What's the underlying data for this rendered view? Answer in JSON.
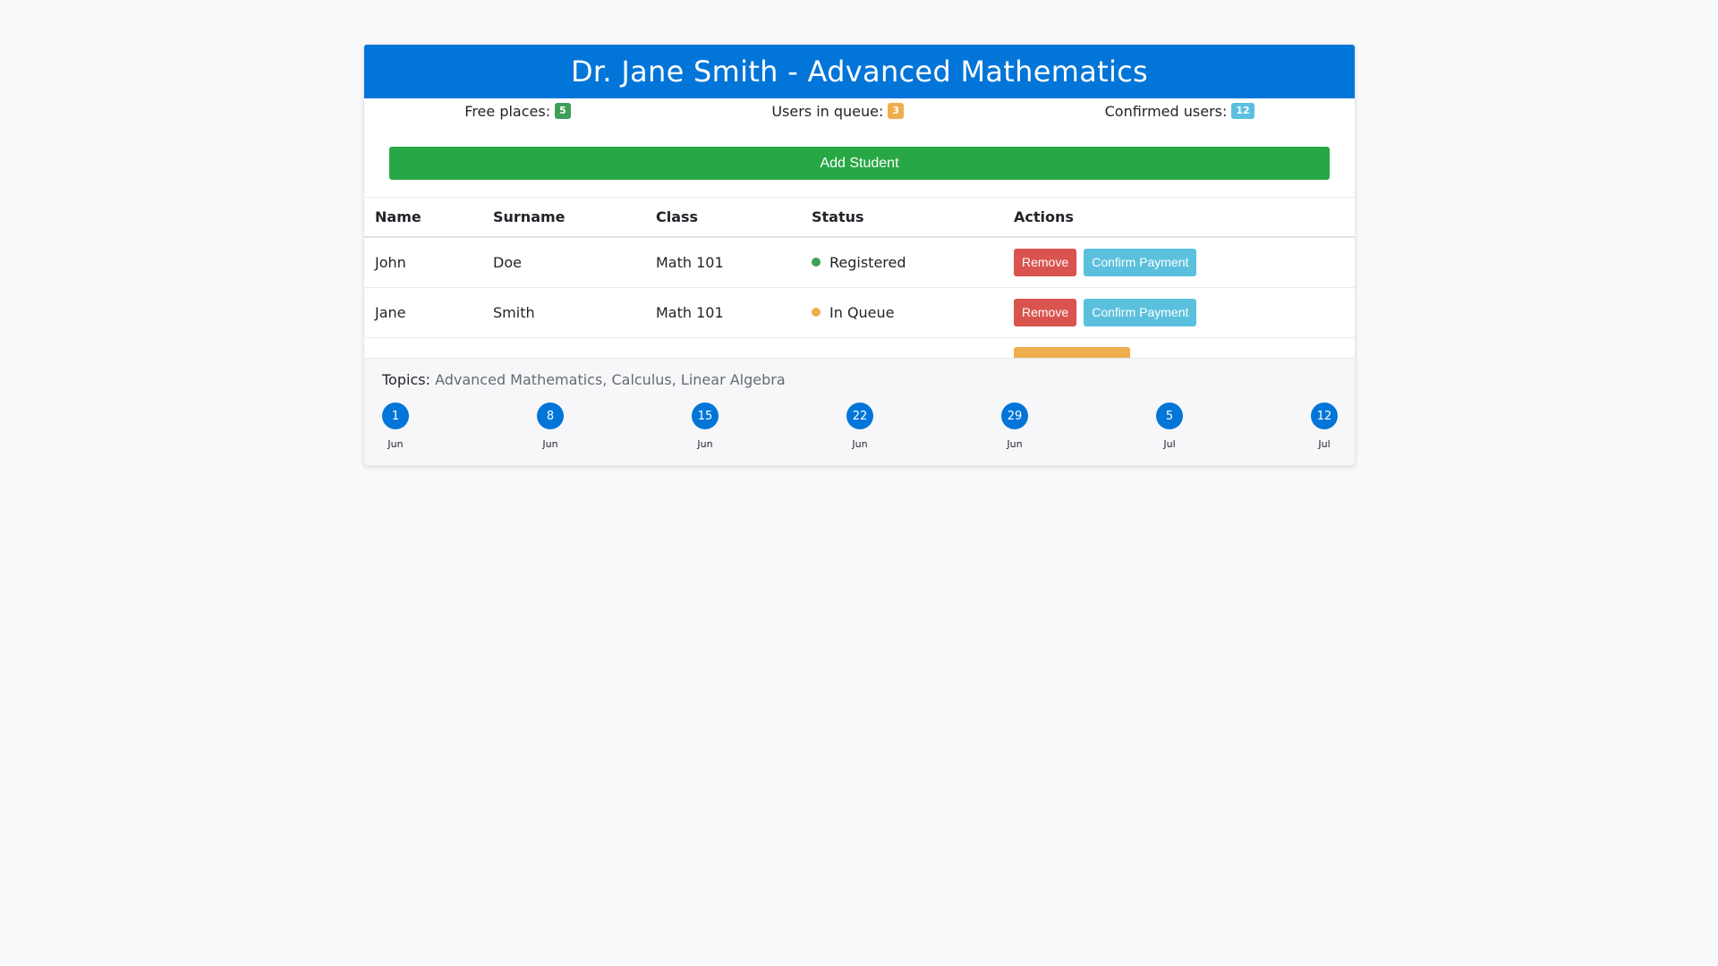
{
  "header": {
    "title": "Dr. Jane Smith - Advanced Mathematics"
  },
  "stats": {
    "free_label": "Free places:",
    "free_count": "5",
    "queue_label": "Users in queue:",
    "queue_count": "3",
    "confirmed_label": "Confirmed users:",
    "confirmed_count": "12"
  },
  "colors": {
    "primary": "#0275d8",
    "success": "#28a745",
    "danger": "#d9534f",
    "info": "#5bc0de",
    "warning": "#f0ad4e",
    "registered": "#3d9f58",
    "in_queue": "#f0ad4e"
  },
  "add_button": {
    "label": "Add Student"
  },
  "table": {
    "columns": [
      "Name",
      "Surname",
      "Class",
      "Status",
      "Actions"
    ],
    "rows": [
      {
        "name": "John",
        "surname": "Doe",
        "class": "Math 101",
        "status": "Registered",
        "remove_label": "Remove",
        "confirm_label": "Confirm Payment"
      },
      {
        "name": "Jane",
        "surname": "Smith",
        "class": "Math 101",
        "status": "In Queue",
        "remove_label": "Remove",
        "confirm_label": "Confirm Payment"
      }
    ]
  },
  "footer": {
    "topics_label": "Topics:",
    "topics_value": "Advanced Mathematics, Calculus, Linear Algebra",
    "timeline": [
      {
        "day": "1",
        "month": "Jun"
      },
      {
        "day": "8",
        "month": "Jun"
      },
      {
        "day": "15",
        "month": "Jun"
      },
      {
        "day": "22",
        "month": "Jun"
      },
      {
        "day": "29",
        "month": "Jun"
      },
      {
        "day": "5",
        "month": "Jul"
      },
      {
        "day": "12",
        "month": "Jul"
      }
    ]
  }
}
